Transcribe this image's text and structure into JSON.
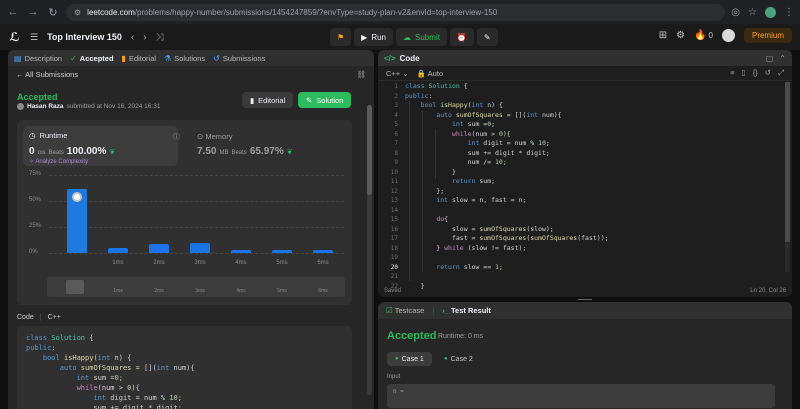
{
  "browser": {
    "url_host": "leetcode.com",
    "url_path": "/problems/happy-number/submissions/1454247859/?envType=study-plan-v2&envId=top-interview-150"
  },
  "topnav": {
    "title": "Top Interview 150",
    "run_label": "Run",
    "submit_label": "Submit",
    "fire_count": "0",
    "premium_label": "Premium"
  },
  "left_tabs": [
    {
      "label": "Description",
      "icon": "document-icon"
    },
    {
      "label": "Accepted",
      "icon": "check-icon"
    },
    {
      "label": "Editorial",
      "icon": "book-icon"
    },
    {
      "label": "Solutions",
      "icon": "flask-icon"
    },
    {
      "label": "Submissions",
      "icon": "history-icon"
    }
  ],
  "subbar": {
    "back_label": "All Submissions"
  },
  "submission": {
    "status": "Accepted",
    "author": "Hasan Raza",
    "submitted_text": "submitted at Nov 16, 2024 16:31",
    "editorial_btn": "Editorial",
    "solution_btn": "Solution"
  },
  "runtime": {
    "label": "Runtime",
    "value": "0",
    "unit": "ms",
    "beats_label": "Beats",
    "beats_pct": "100.00%",
    "analyze_label": "Analyze Complexity"
  },
  "memory": {
    "label": "Memory",
    "value": "7.50",
    "unit": "MB",
    "beats_label": "Beats",
    "beats_pct": "65.97%"
  },
  "chart_data": {
    "type": "bar",
    "categories": [
      "0ms",
      "1ms",
      "2ms",
      "3ms",
      "4ms",
      "5ms",
      "6ms"
    ],
    "values": [
      62,
      5,
      9,
      10,
      3,
      3,
      3
    ],
    "yticks": [
      "75%",
      "50%",
      "25%",
      "0%"
    ],
    "xtick_labels": [
      "1ms",
      "2ms",
      "3ms",
      "4ms",
      "5ms",
      "6ms"
    ],
    "ylim": [
      0,
      75
    ],
    "scrubber_labels": [
      "1ms",
      "2ms",
      "3ms",
      "4ms",
      "5ms",
      "6ms"
    ]
  },
  "code_section": {
    "label": "Code",
    "lang": "C++"
  },
  "left_code": [
    "class Solution {",
    "public:",
    "    bool isHappy(int n) {",
    "        auto sumOfSquares = [](int num){",
    "            int sum =0;",
    "            while(num > 0){",
    "                int digit = num % 10;",
    "                sum += digit * digit;"
  ],
  "editor": {
    "tab_label": "Code",
    "lang": "C++",
    "mode": "Auto",
    "saved_label": "Saved",
    "cursor_pos": "Ln 20, Col 26",
    "line_numbers": [
      "1",
      "2",
      "3",
      "4",
      "5",
      "6",
      "7",
      "8",
      "9",
      "10",
      "11",
      "12",
      "13",
      "14",
      "15",
      "16",
      "17",
      "18",
      "19",
      "20",
      "21",
      "22"
    ],
    "lines": [
      "class Solution {",
      "public:",
      "    bool isHappy(int n) {",
      "        auto sumOfSquares = [](int num){",
      "            int sum =0;",
      "            while(num > 0){",
      "                int digit = num % 10;",
      "                sum += digit * digit;",
      "                num /= 10;",
      "            }",
      "            return sum;",
      "        };",
      "        int slow = n, fast = n;",
      "",
      "        do{",
      "            slow = sumOfSquares(slow);",
      "            fast = sumOfSquares(sumOfSquares(fast));",
      "        } while (slow != fast);",
      "",
      "        return slow == 1;",
      "",
      "    }"
    ]
  },
  "testpanel": {
    "testcase_tab": "Testcase",
    "result_tab": "Test Result",
    "status": "Accepted",
    "runtime_text": "Runtime: 0 ms",
    "case1": "Case 1",
    "case2": "Case 2",
    "input_label": "Input",
    "input_value": "n ="
  }
}
